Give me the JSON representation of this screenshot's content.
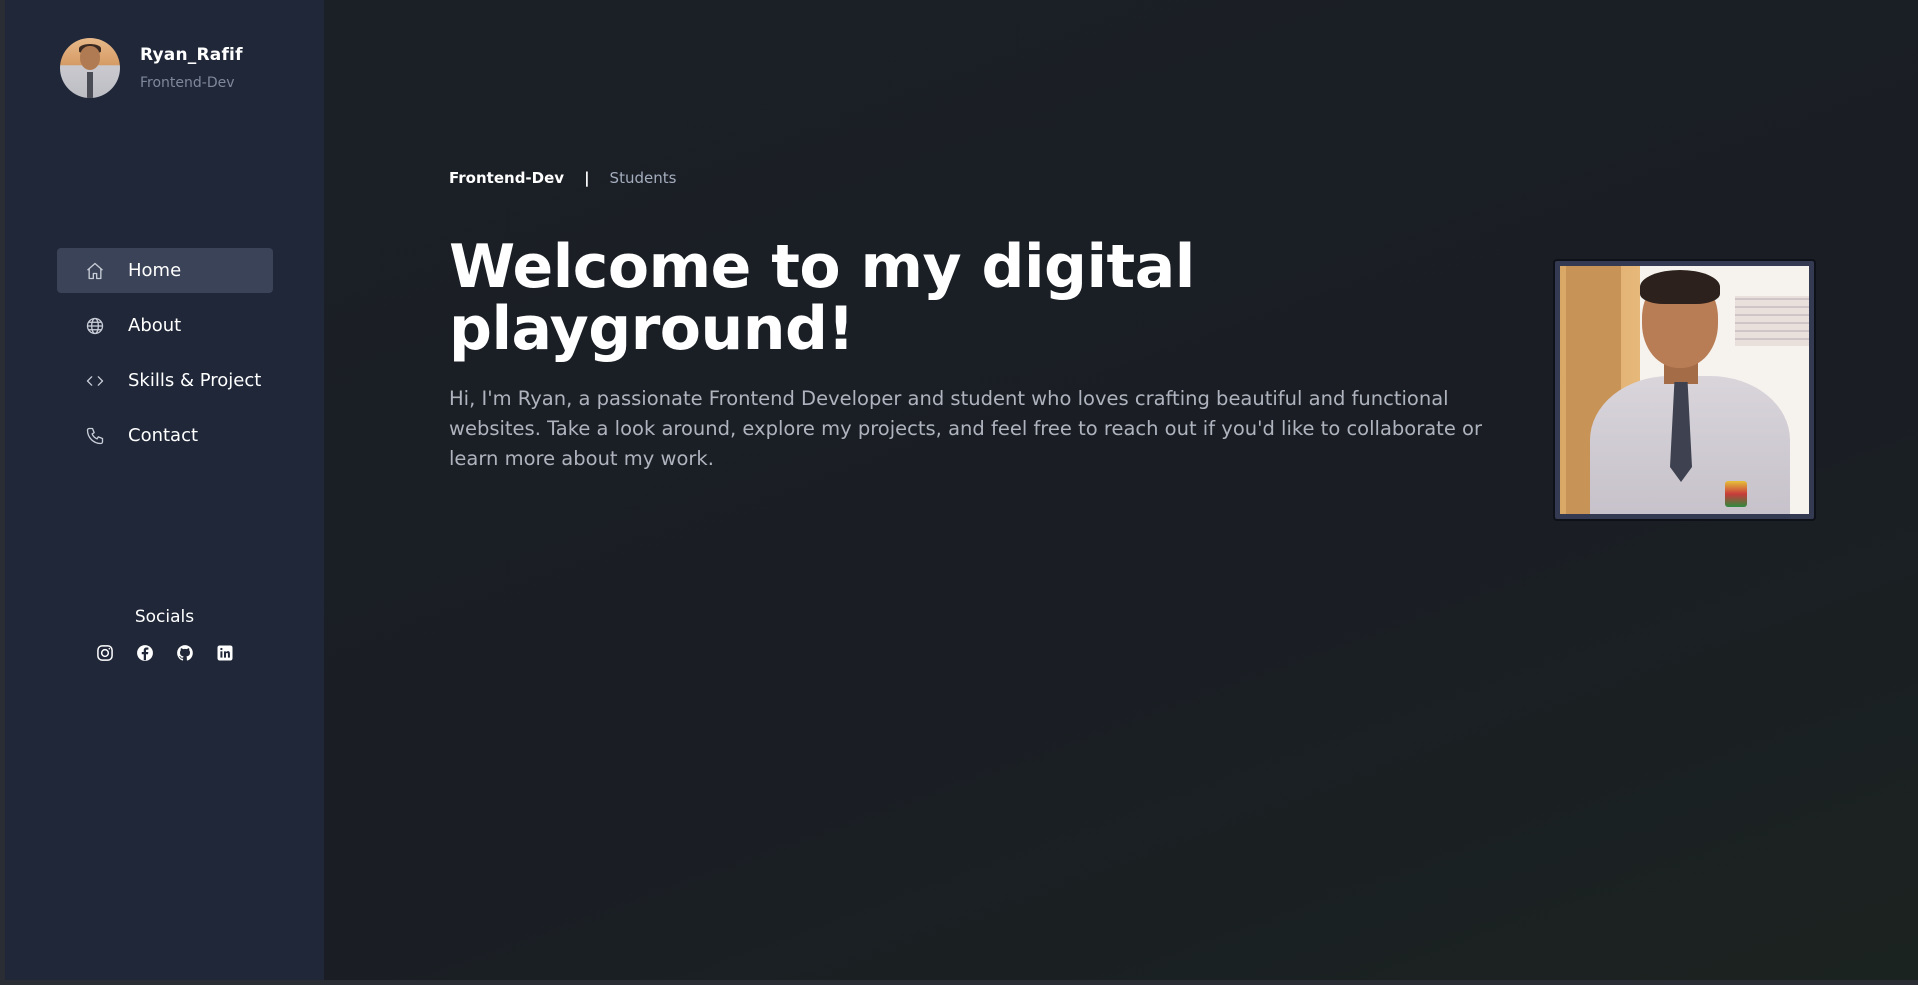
{
  "profile": {
    "name": "Ryan_Rafif",
    "role": "Frontend-Dev"
  },
  "nav": {
    "items": [
      {
        "label": "Home",
        "icon": "home-icon",
        "active": true
      },
      {
        "label": "About",
        "icon": "globe-icon",
        "active": false
      },
      {
        "label": "Skills & Project",
        "icon": "code-icon",
        "active": false
      },
      {
        "label": "Contact",
        "icon": "phone-icon",
        "active": false
      }
    ]
  },
  "socials": {
    "title": "Socials",
    "icons": [
      "instagram-icon",
      "facebook-icon",
      "github-icon",
      "linkedin-icon"
    ]
  },
  "breadcrumb": {
    "primary": "Frontend-Dev",
    "separator": "|",
    "secondary": "Students"
  },
  "hero": {
    "title": "Welcome to my digital playground!",
    "text": "Hi, I'm Ryan, a passionate Frontend Developer and student who loves crafting beautiful and functional websites. Take a look around, explore my projects, and feel free to reach out if you'd like to collaborate or learn more about my work."
  },
  "colors": {
    "sidebar_bg": "#1f2739",
    "main_bg": "#1b1f26",
    "active_nav_bg": "#3a4357",
    "text_primary": "#ffffff",
    "text_muted": "#aeb3bd"
  }
}
